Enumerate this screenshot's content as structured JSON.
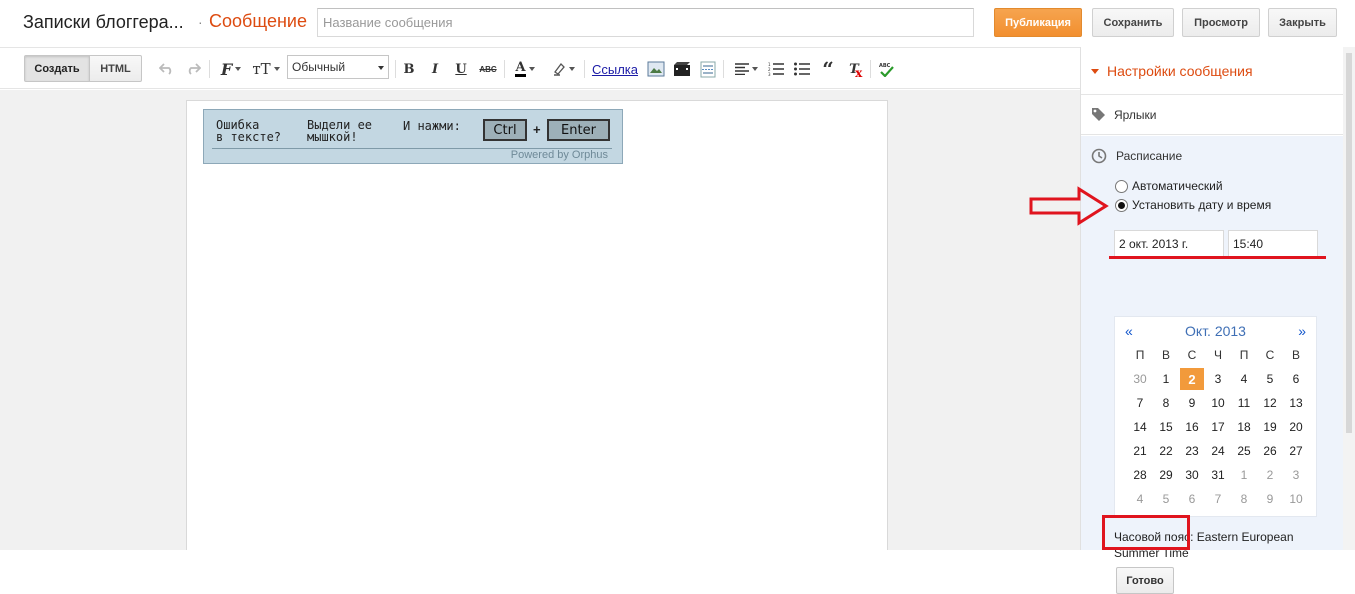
{
  "header": {
    "blog_title": "Записки блоггера...",
    "separator": "·",
    "page_kind": "Сообщение",
    "title_placeholder": "Название сообщения",
    "publish_label": "Публикация",
    "save_label": "Сохранить",
    "preview_label": "Просмотр",
    "close_label": "Закрыть"
  },
  "toolbar": {
    "mode_create": "Создать",
    "mode_html": "HTML",
    "font_select": "Обычный",
    "link_label": "Ссылка"
  },
  "editor": {
    "orphus": {
      "col1_line1": "Ошибка",
      "col1_line2": "в тексте?",
      "col2_line1": "Выдели ее",
      "col2_line2": "мышкой!",
      "col3": "И нажми:",
      "key1": "Ctrl",
      "plus": "+",
      "key2": "Enter",
      "powered": "Powered by Orphus"
    }
  },
  "sidebar": {
    "section_title": "Настройки сообщения",
    "labels_title": "Ярлыки",
    "schedule_title": "Расписание",
    "radio_auto": "Автоматический",
    "radio_manual": "Установить дату и время",
    "date_value": "2 окт. 2013 г.",
    "time_value": "15:40",
    "calendar": {
      "prev": "«",
      "next": "»",
      "month": "Окт. 2013",
      "weekdays": [
        "П",
        "В",
        "С",
        "Ч",
        "П",
        "С",
        "В"
      ],
      "weeks": [
        [
          "30",
          "1",
          "2",
          "3",
          "4",
          "5",
          "6"
        ],
        [
          "7",
          "8",
          "9",
          "10",
          "11",
          "12",
          "13"
        ],
        [
          "14",
          "15",
          "16",
          "17",
          "18",
          "19",
          "20"
        ],
        [
          "21",
          "22",
          "23",
          "24",
          "25",
          "26",
          "27"
        ],
        [
          "28",
          "29",
          "30",
          "31",
          "1",
          "2",
          "3"
        ],
        [
          "4",
          "5",
          "6",
          "7",
          "8",
          "9",
          "10"
        ]
      ],
      "selected_day": "2"
    },
    "timezone_line1": "Часовой пояс: Eastern European",
    "timezone_line2": "Summer Time",
    "done_label": "Готово"
  },
  "colors": {
    "accent_orange": "#dd4b10",
    "publish_button": "#f28f2f",
    "selected_day": "#f29a3b",
    "annotation_red": "#e0141e"
  }
}
